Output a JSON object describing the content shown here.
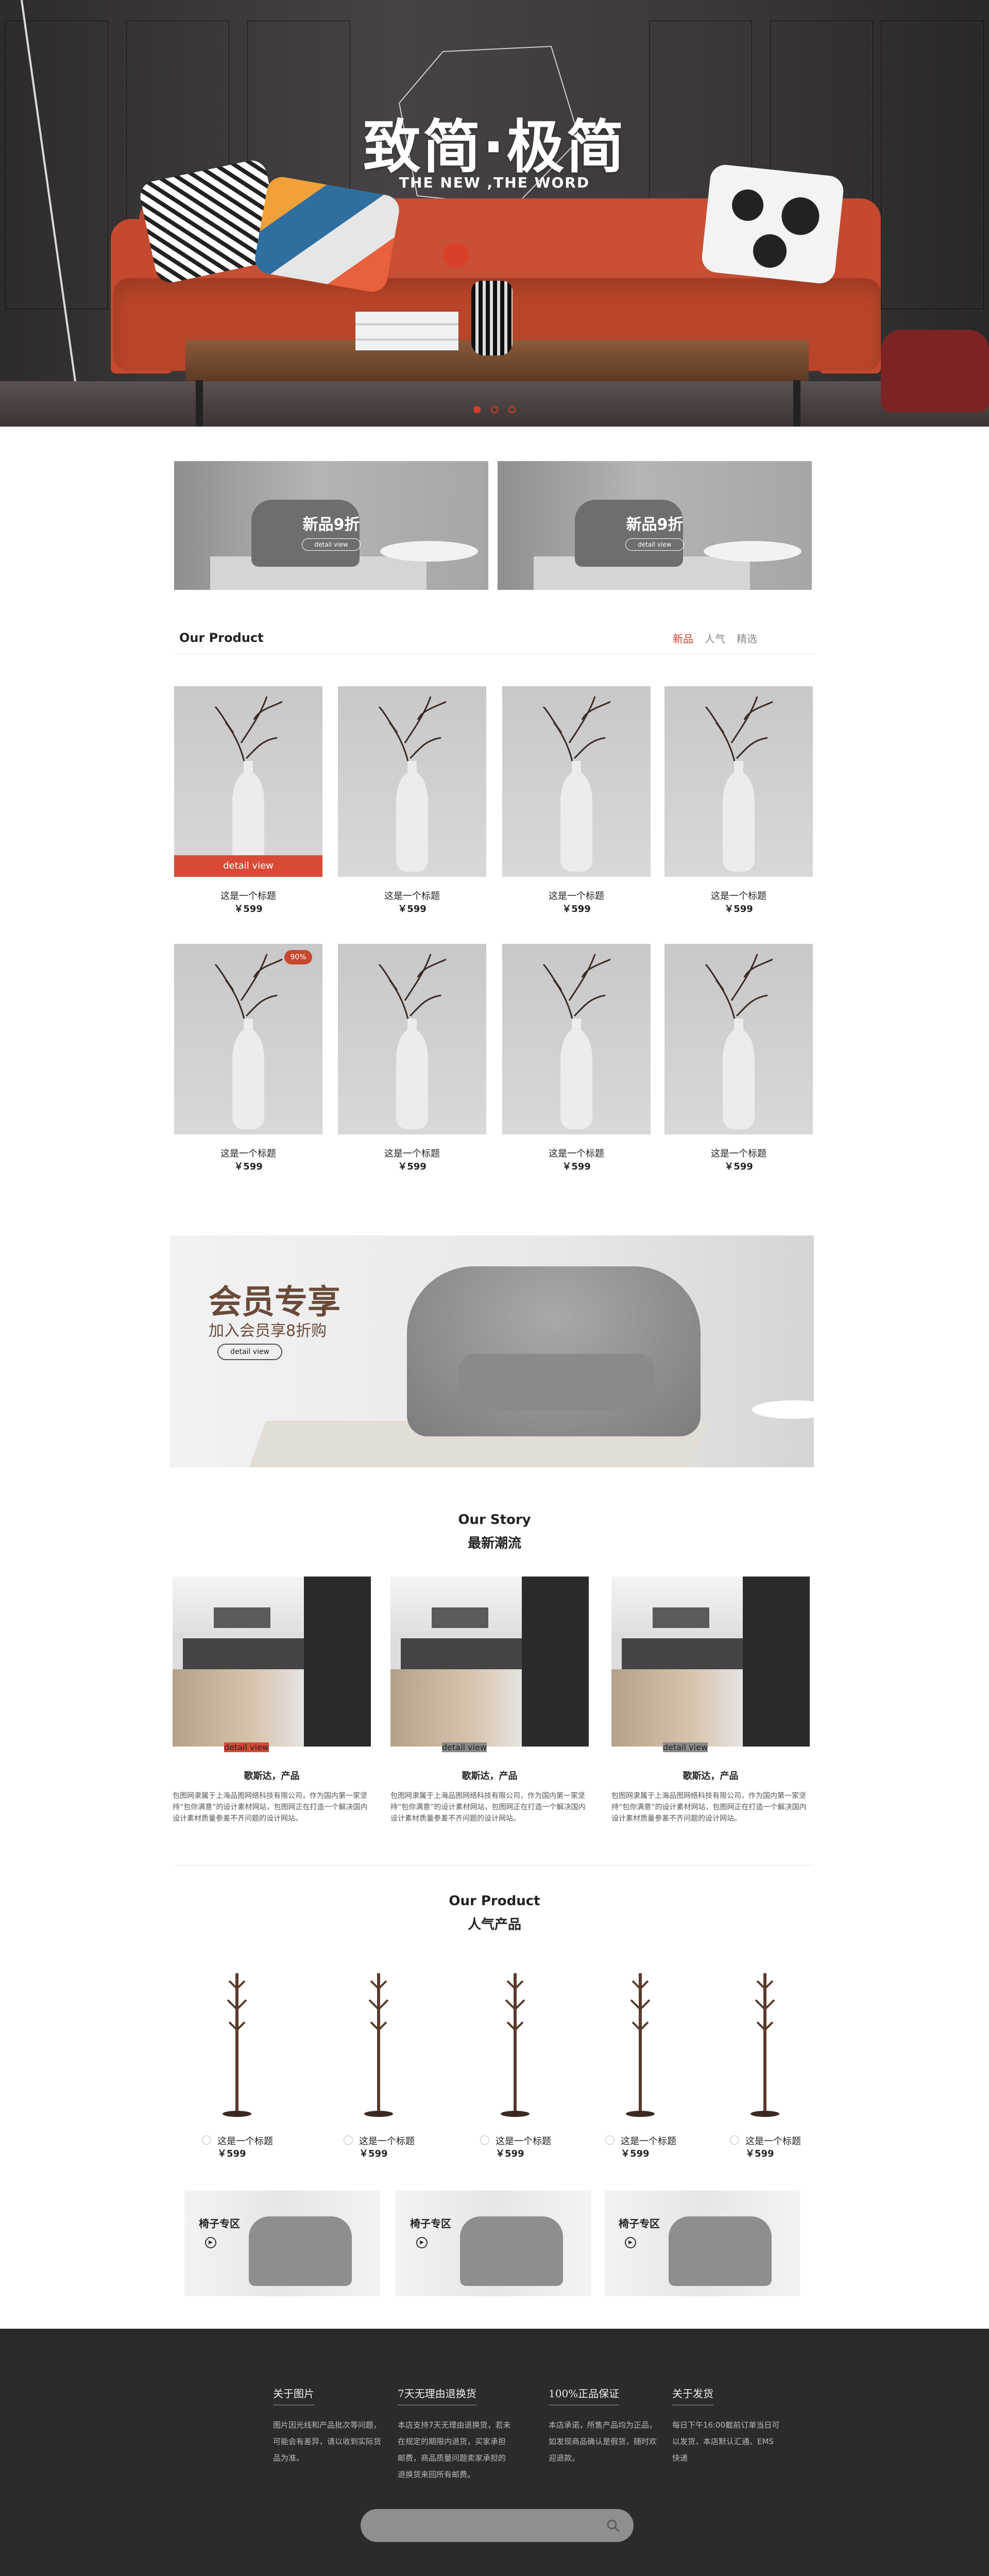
{
  "hero": {
    "title": "致简·极简",
    "subtitle": "THE NEW ,THE WORD",
    "slides": 3,
    "active_slide": 1
  },
  "promos": [
    {
      "text": "新品9折",
      "btn": "detail view"
    },
    {
      "text": "新品9折",
      "btn": "detail view"
    }
  ],
  "product_section": {
    "title": "Our Product",
    "tabs": [
      "新品",
      "人气",
      "精选"
    ],
    "active_tab": 0
  },
  "products": [
    {
      "name": "这是一个标题",
      "price": "￥599",
      "detail": "detail view"
    },
    {
      "name": "这是一个标题",
      "price": "￥599"
    },
    {
      "name": "这是一个标题",
      "price": "￥599"
    },
    {
      "name": "这是一个标题",
      "price": "￥599"
    },
    {
      "name": "这是一个标题",
      "price": "￥599",
      "badge": "90%"
    },
    {
      "name": "这是一个标题",
      "price": "￥599"
    },
    {
      "name": "这是一个标题",
      "price": "￥599"
    },
    {
      "name": "这是一个标题",
      "price": "￥599"
    }
  ],
  "member": {
    "title": "会员专享",
    "subtitle": "加入会员享8折购",
    "btn": "detail view"
  },
  "story": {
    "title": "Our Story",
    "subtitle": "最新潮流",
    "items": [
      {
        "name": "歌斯达，产品",
        "btn": "detail view",
        "btn_color": "#d84a36",
        "desc": "包图网隶属于上海品图网络科技有限公司，作为国内第一家坚持“包你满意”的设计素材网站，包图网正在打造一个解决国内设计素材质量参差不齐问题的设计网站。"
      },
      {
        "name": "歌斯达，产品",
        "btn": "detail view",
        "btn_color": "#8a8a8a",
        "desc": "包图网隶属于上海品图网络科技有限公司，作为国内第一家坚持“包你满意”的设计素材网站，包图网正在打造一个解决国内设计素材质量参差不齐问题的设计网站。"
      },
      {
        "name": "歌斯达，产品",
        "btn": "detail view",
        "btn_color": "#8a8a8a",
        "desc": "包图网隶属于上海品图网络科技有限公司，作为国内第一家坚持“包你满意”的设计素材网站，包图网正在打造一个解决国内设计素材质量参差不齐问题的设计网站。"
      }
    ]
  },
  "popular": {
    "title": "Our Product",
    "subtitle": "人气产品",
    "items": [
      {
        "name": "这是一个标题",
        "price": "￥599"
      },
      {
        "name": "这是一个标题",
        "price": "￥599"
      },
      {
        "name": "这是一个标题",
        "price": "￥599"
      },
      {
        "name": "这是一个标题",
        "price": "￥599"
      },
      {
        "name": "这是一个标题",
        "price": "￥599"
      }
    ]
  },
  "zones": [
    {
      "title": "椅子专区"
    },
    {
      "title": "椅子专区"
    },
    {
      "title": "椅子专区"
    }
  ],
  "footer": {
    "cols": [
      {
        "heading": "关于图片",
        "text": "图片因光线和产品批次等问题，可能会有差异，请以收到实际货品为准。"
      },
      {
        "heading": "7天无理由退换货",
        "text": "本店支持7天无理由退换货，若未在规定的期限内退货，买家承担邮费，商品质量问题卖家承担的退换货来回所有邮费。"
      },
      {
        "heading": "100%正品保证",
        "text": "本店承诺，所售产品均为正品，如发现商品确认是假货，随时欢迎退款。"
      },
      {
        "heading": "关于发货",
        "text": "每日下午16:00截前订单当日可以发货，本店默认汇通、EMS快递"
      }
    ],
    "search_placeholder": ""
  }
}
